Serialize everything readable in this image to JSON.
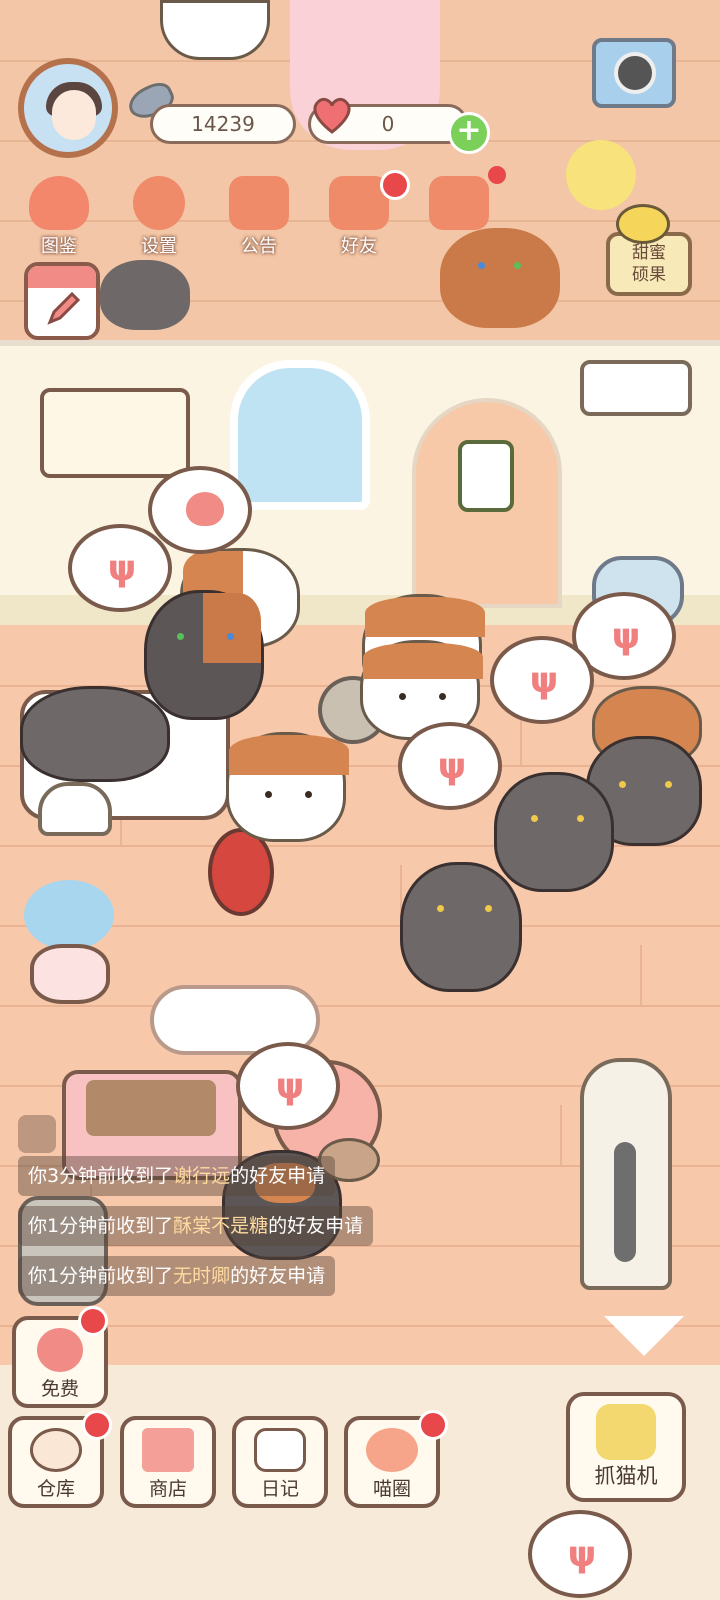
{
  "hud": {
    "fish_count": "14239",
    "heart_count": "0"
  },
  "menu": [
    {
      "label": "图鉴"
    },
    {
      "label": "设置"
    },
    {
      "label": "公告"
    },
    {
      "label": "好友"
    }
  ],
  "side": {
    "sweet_label": "甜蜜\n硕果"
  },
  "notifications": [
    {
      "prefix": "你3分钟前收到了",
      "name": "谢行远",
      "suffix": "的好友申请"
    },
    {
      "prefix": "你1分钟前收到了",
      "name": "酥棠不是糖",
      "suffix": "的好友申请"
    },
    {
      "prefix": "你1分钟前收到了",
      "name": "无时卿",
      "suffix": "的好友申请"
    }
  ],
  "bottom": {
    "free_label": "免费",
    "warehouse_label": "仓库",
    "shop_label": "商店",
    "diary_label": "日记",
    "circle_label": "喵圈",
    "claw_label": "抓猫机"
  },
  "colors": {
    "red_dot": "#e8484a",
    "notif_name": "#ffdba0",
    "wall": "#fbf4e3",
    "floor": "#f7c8aa"
  }
}
